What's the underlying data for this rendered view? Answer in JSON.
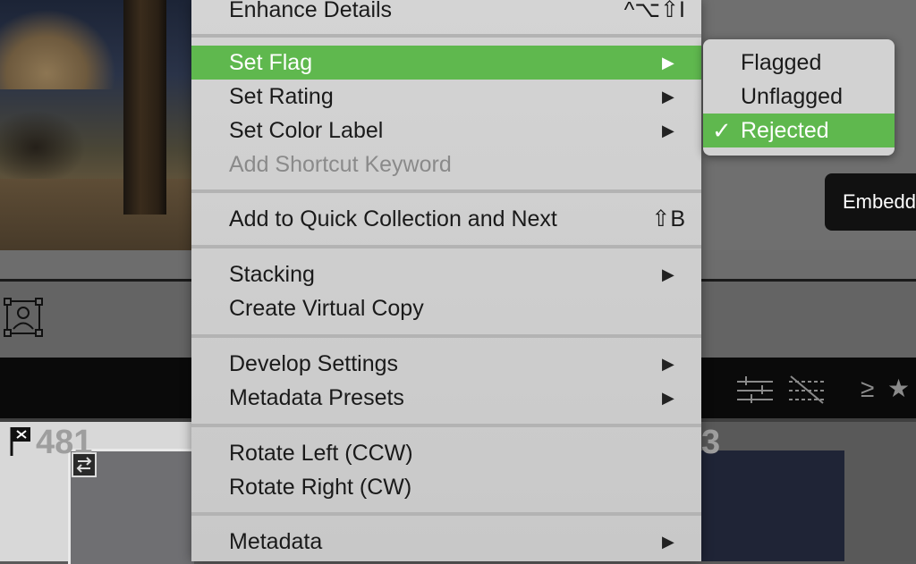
{
  "menu": {
    "items": [
      {
        "label": "Enhance Details",
        "shortcut": "^⌥⇧I"
      },
      {
        "label": "Set Flag",
        "submenu": true,
        "highlighted": true
      },
      {
        "label": "Set Rating",
        "submenu": true
      },
      {
        "label": "Set Color Label",
        "submenu": true
      },
      {
        "label": "Add Shortcut Keyword",
        "disabled": true
      },
      {
        "label": "Add to Quick Collection and Next",
        "shortcut": "⇧B"
      },
      {
        "label": "Stacking",
        "submenu": true
      },
      {
        "label": "Create Virtual Copy"
      },
      {
        "label": "Develop Settings",
        "submenu": true
      },
      {
        "label": "Metadata Presets",
        "submenu": true
      },
      {
        "label": "Rotate Left (CCW)"
      },
      {
        "label": "Rotate Right (CW)"
      },
      {
        "label": "Metadata",
        "submenu": true
      }
    ],
    "arrow": "▶",
    "highlight_color": "#5fb84e"
  },
  "submenu": {
    "items": [
      {
        "label": "Flagged"
      },
      {
        "label": "Unflagged"
      },
      {
        "label": "Rejected",
        "checked": true
      }
    ],
    "check": "✓"
  },
  "tooltip": {
    "text": "Embedd"
  },
  "filmstrip": {
    "cell_a_number": "481",
    "cell_b_number": "3"
  },
  "filters": {
    "gte": "≥",
    "star": "★"
  },
  "icons": [
    "crop-icon",
    "flag-rejected-icon",
    "swap-icon",
    "sliders-icon",
    "sliders-disabled-icon",
    "star-icon"
  ]
}
